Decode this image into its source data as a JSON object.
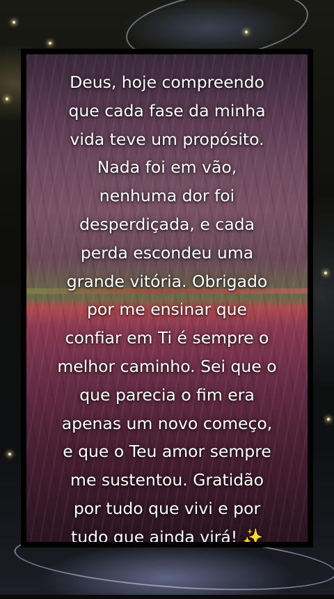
{
  "prayer": {
    "text": "Deus, hoje compreendo\nque cada fase da minha\nvida teve um propósito.\nNada foi em vão,\nnenhuma dor foi\ndesperdiçada, e cada\nperda escondeu uma\ngrande vitória. Obrigado\npor me ensinar que\nconfiar em Ti é sempre o\nmelhor caminho. Sei que o\nque parecia o fim era\napenas um novo começo,\ne que o Teu amor sempre\nme sustentou. Gratidão\npor tudo que vivi e por\ntudo que ainda virá! ✨"
  },
  "colors": {
    "frame": "#000000",
    "text": "#ffffff",
    "sky": "#6e4a60",
    "tulip_field": "#8a3a52"
  }
}
